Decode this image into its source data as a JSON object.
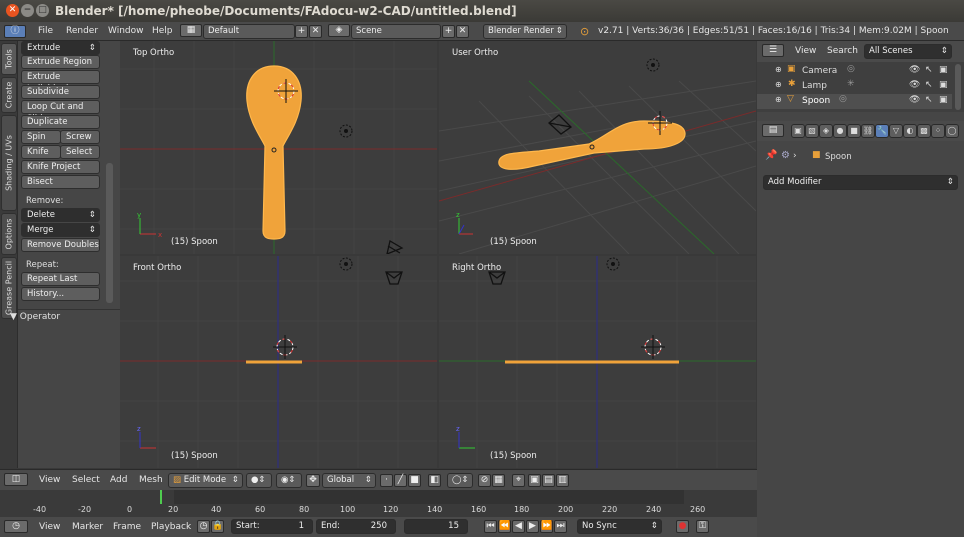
{
  "window": {
    "title": "Blender* [/home/pheobe/Documents/FAdocu-w2-CAD/untitled.blend]",
    "close_icon": "✕",
    "min_icon": "−",
    "max_icon": "□"
  },
  "info_header": {
    "menus": [
      "File",
      "Render",
      "Window",
      "Help"
    ],
    "layout": "Default",
    "scene": "Scene",
    "engine": "Blender Render",
    "stats": "v2.71 | Verts:36/36 | Edges:51/51 | Faces:16/16 | Tris:34 | Mem:9.02M | Spoon"
  },
  "tool_tabs": [
    "Tools",
    "Create",
    "Shading / UVs",
    "Options",
    "Grease Pencil"
  ],
  "tools": {
    "extrude": "Extrude",
    "extrude_region": "Extrude Region",
    "extrude_individual": "Extrude Individual",
    "subdivide": "Subdivide",
    "loop_cut": "Loop Cut and Slide",
    "duplicate": "Duplicate",
    "spin": "Spin",
    "screw": "Screw",
    "knife": "Knife",
    "select": "Select",
    "knife_project": "Knife Project",
    "bisect": "Bisect",
    "remove_label": "Remove:",
    "delete": "Delete",
    "merge": "Merge",
    "remove_doubles": "Remove Doubles",
    "repeat_label": "Repeat:",
    "repeat_last": "Repeat Last",
    "history": "History...",
    "operator": "Operator"
  },
  "viewports": {
    "top": {
      "name": "Top Ortho",
      "object": "(15) Spoon"
    },
    "user": {
      "name": "User Ortho",
      "object": "(15) Spoon"
    },
    "front": {
      "name": "Front Ortho",
      "object": "(15) Spoon"
    },
    "right": {
      "name": "Right Ortho",
      "object": "(15) Spoon"
    }
  },
  "outliner": {
    "view": "View",
    "search": "Search",
    "filter": "All Scenes",
    "items": [
      {
        "label": "Camera"
      },
      {
        "label": "Lamp"
      },
      {
        "label": "Spoon"
      }
    ]
  },
  "properties": {
    "object": "Spoon",
    "add_modifier": "Add Modifier"
  },
  "view3d_header": {
    "view": "View",
    "select": "Select",
    "add": "Add",
    "mesh": "Mesh",
    "mode": "Edit Mode",
    "orientation": "Global"
  },
  "timeline": {
    "ticks": [
      "-40",
      "-20",
      "0",
      "20",
      "40",
      "60",
      "80",
      "100",
      "120",
      "140",
      "160",
      "180",
      "200",
      "220",
      "240",
      "260"
    ],
    "current_frame": 15,
    "view": "View",
    "marker": "Marker",
    "frame": "Frame",
    "playback": "Playback",
    "start_label": "Start:",
    "start": "1",
    "end_label": "End:",
    "end": "250",
    "frame_value": "15",
    "sync": "No Sync"
  },
  "colors": {
    "mesh": "#f0a33a",
    "viewport_bg": "#3d3d3d",
    "x_axis": "#8c2a2a",
    "y_axis": "#2a7d2a",
    "z_axis": "#2a2a8c"
  }
}
